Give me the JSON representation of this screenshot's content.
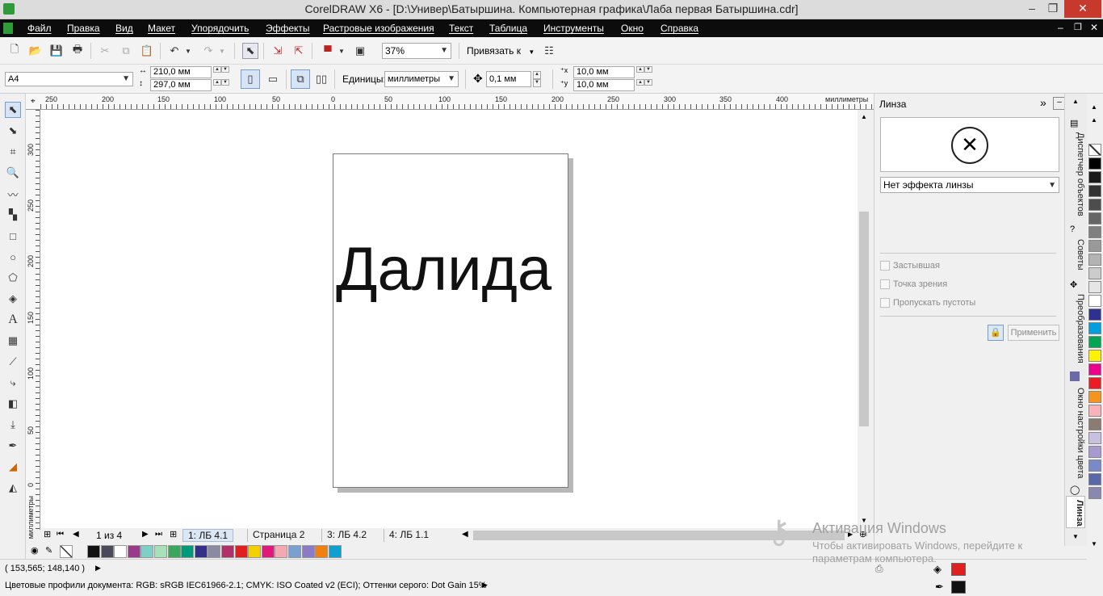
{
  "window": {
    "title": "CorelDRAW X6 - [D:\\Универ\\Батыршина. Компьютерная графика\\Лаба первая Батыршина.cdr]",
    "minimize": "–",
    "restore": "❐",
    "close": "✕"
  },
  "menu": [
    "Файл",
    "Правка",
    "Вид",
    "Макет",
    "Упорядочить",
    "Эффекты",
    "Растровые изображения",
    "Текст",
    "Таблица",
    "Инструменты",
    "Окно",
    "Справка"
  ],
  "toolbar": {
    "zoom": "37%",
    "snap_label": "Привязать к"
  },
  "property_bar": {
    "paper_size": "A4",
    "width": "210,0 мм",
    "height": "297,0 мм",
    "units_label": "Единицы:",
    "units_value": "миллиметры",
    "nudge": "0,1 мм",
    "dup_x": "10,0 мм",
    "dup_y": "10,0 мм"
  },
  "ruler": {
    "h_ticks": [
      "250",
      "200",
      "150",
      "100",
      "50",
      "0",
      "50",
      "100",
      "150",
      "200",
      "250",
      "300",
      "350",
      "400"
    ],
    "h_unit": "миллиметры",
    "v_ticks": [
      "300",
      "250",
      "200",
      "150",
      "100",
      "50",
      "0"
    ],
    "v_unit": "миллиметры"
  },
  "document": {
    "text": "Далида"
  },
  "page_nav": {
    "counter": "1 из 4",
    "tabs": [
      "1: ЛБ 4.1",
      "Страница 2",
      "3: ЛБ 4.2",
      "4: ЛБ 1.1"
    ]
  },
  "status": {
    "coords": "( 153,565; 148,140 )",
    "profiles": "Цветовые профили документа: RGB: sRGB IEC61966-2.1; CMYK: ISO Coated v2 (ECI); Оттенки серого: Dot Gain 15%",
    "fill_color": "#e0201e",
    "outline_color": "#111111"
  },
  "lens_docker": {
    "title": "Линза",
    "effect": "Нет эффекта линзы",
    "options": [
      "Застывшая",
      "Точка зрения",
      "Пропускать пустоты"
    ],
    "apply": "Применить"
  },
  "side_tabs": [
    "Диспетчер объектов",
    "Советы",
    "Преобразования",
    "Окно настройки цвета",
    "Линза"
  ],
  "watermark": {
    "title": "Активация Windows",
    "line1": "Чтобы активировать Windows, перейдите к",
    "line2": "параметрам компьютера."
  },
  "bottom_palette": [
    "#111111",
    "#4a4a5a",
    "#ffffff",
    "#9a3a8a",
    "#7ecfc8",
    "#a8e0b8",
    "#3aa85a",
    "#009a7a",
    "#34308a",
    "#8a8aa0",
    "#b0306a",
    "#e0201e",
    "#f2d000",
    "#e0187a",
    "#f4a8b0",
    "#7aa0d0",
    "#8a7ac8",
    "#f08010",
    "#10a0d0"
  ],
  "right_palette": [
    "#000000",
    "#1a1a1a",
    "#333333",
    "#4d4d4d",
    "#666666",
    "#808080",
    "#999999",
    "#b3b3b3",
    "#cccccc",
    "#e6e6e6",
    "#ffffff",
    "#2e3192",
    "#00a0e0",
    "#00a651",
    "#fff200",
    "#ec008c",
    "#ed1c24",
    "#f7941d",
    "#f9b2b7",
    "#8c7b70",
    "#c8c0e0",
    "#a89ad0",
    "#7a8ac8",
    "#5868a8",
    "#8888b0"
  ],
  "colors": {
    "menubar": "#0c0c0c",
    "accent_green": "#2e9a3a"
  }
}
